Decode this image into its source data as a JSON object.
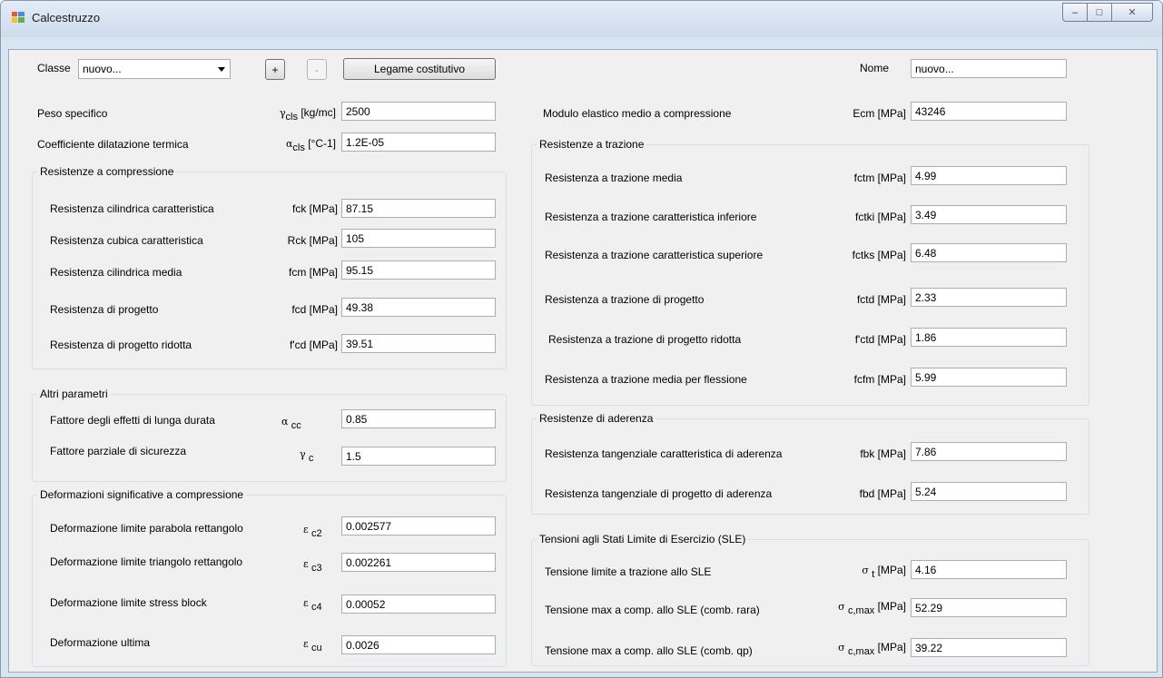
{
  "window": {
    "title": "Calcestruzzo",
    "controls": {
      "minimize": "–",
      "maximize": "□",
      "close": "✕"
    }
  },
  "top": {
    "classe_label": "Classe",
    "classe_value": "nuovo...",
    "add_label": "+",
    "remove_label": "-",
    "legame_label": "Legame costitutivo",
    "nome_label": "Nome",
    "nome_value": "nuovo..."
  },
  "left": {
    "peso": {
      "label": "Peso specifico",
      "sym": "γ",
      "sub": "cls",
      "unit": "[kg/mc]",
      "value": "2500"
    },
    "coeff": {
      "label": "Coefficiente dilatazione termica",
      "sym": "α",
      "sub": "cls",
      "unit": "[°C-1]",
      "value": "1.2E-05"
    },
    "compressione": {
      "title": "Resistenze a compressione",
      "rows": [
        {
          "label": "Resistenza cilindrica caratteristica",
          "unit": "fck [MPa]",
          "value": "87.15"
        },
        {
          "label": "Resistenza cubica caratteristica",
          "unit": "Rck [MPa]",
          "value": "105"
        },
        {
          "label": "Resistenza cilindrica media",
          "unit": "fcm [MPa]",
          "value": "95.15"
        },
        {
          "label": "Resistenza di progetto",
          "unit": "fcd [MPa]",
          "value": "49.38"
        },
        {
          "label": "Resistenza di progetto ridotta",
          "unit": "f'cd [MPa]",
          "value": "39.51"
        }
      ]
    },
    "altri": {
      "title": "Altri parametri",
      "rows": [
        {
          "label": "Fattore degli effetti di lunga durata",
          "sym": "α",
          "sub": "cc",
          "value": "0.85"
        },
        {
          "label": "Fattore parziale di sicurezza",
          "sym": "γ",
          "sub": "c",
          "value": "1.5"
        }
      ]
    },
    "deformazioni": {
      "title": "Deformazioni significative a compressione",
      "rows": [
        {
          "label": "Deformazione limite parabola rettangolo",
          "sym": "ε",
          "sub": "c2",
          "value": "0.002577"
        },
        {
          "label": "Deformazione limite triangolo rettangolo",
          "sym": "ε",
          "sub": "c3",
          "value": "0.002261"
        },
        {
          "label": "Deformazione limite stress block",
          "sym": "ε",
          "sub": "c4",
          "value": "0.00052"
        },
        {
          "label": "Deformazione ultima",
          "sym": "ε",
          "sub": "cu",
          "value": "0.0026"
        }
      ]
    }
  },
  "right": {
    "modulo": {
      "label": "Modulo elastico medio a compressione",
      "unit": "Ecm [MPa]",
      "value": "43246"
    },
    "trazione": {
      "title": "Resistenze a trazione",
      "rows": [
        {
          "label": "Resistenza a trazione media",
          "unit": "fctm [MPa]",
          "value": "4.99"
        },
        {
          "label": "Resistenza a trazione caratteristica inferiore",
          "unit": "fctki [MPa]",
          "value": "3.49"
        },
        {
          "label": "Resistenza a trazione caratteristica superiore",
          "unit": "fctks [MPa]",
          "value": "6.48"
        },
        {
          "label": "Resistenza a trazione di progetto",
          "unit": "fctd [MPa]",
          "value": "2.33"
        },
        {
          "label": "Resistenza a trazione di progetto ridotta",
          "unit": "f'ctd [MPa]",
          "value": "1.86"
        },
        {
          "label": "Resistenza a trazione media per flessione",
          "unit": "fcfm [MPa]",
          "value": "5.99"
        }
      ]
    },
    "aderenza": {
      "title": "Resistenze di aderenza",
      "rows": [
        {
          "label": "Resistenza tangenziale caratteristica di aderenza",
          "unit": "fbk [MPa]",
          "value": "7.86"
        },
        {
          "label": "Resistenza tangenziale di progetto di aderenza",
          "unit": "fbd [MPa]",
          "value": "5.24"
        }
      ]
    },
    "sle": {
      "title": "Tensioni agli Stati Limite di Esercizio (SLE)",
      "rows": [
        {
          "label": "Tensione limite a trazione allo SLE",
          "sym": "σ",
          "sub": "t",
          "unit": "[MPa]",
          "value": "4.16"
        },
        {
          "label": "Tensione max a comp. allo SLE (comb. rara)",
          "sym": "σ",
          "sub": "c,max",
          "unit": "[MPa]",
          "value": "52.29"
        },
        {
          "label": "Tensione max a comp. allo SLE (comb. qp)",
          "sym": "σ",
          "sub": "c,max",
          "unit": "[MPa]",
          "value": "39.22"
        }
      ]
    }
  }
}
